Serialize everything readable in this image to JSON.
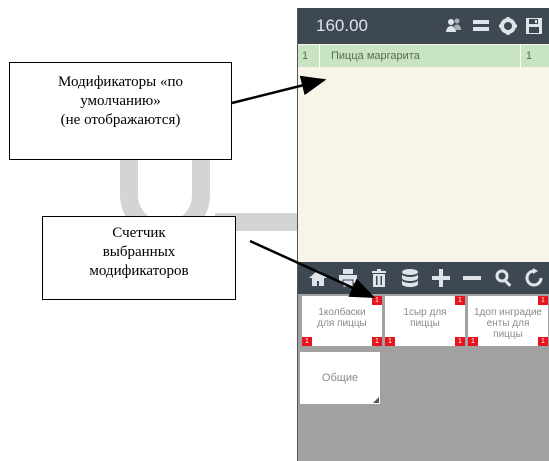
{
  "app": {
    "total": "160.00",
    "toolbar_icons": [
      "users-icon",
      "menu-icon",
      "gear-icon",
      "save-icon"
    ],
    "order_line": {
      "qty_left": "1",
      "name": "Пицца маргарита",
      "qty_right": "1"
    },
    "bottom_tools": [
      "home-icon",
      "print-icon",
      "trash-icon",
      "database-icon",
      "plus-icon",
      "minus-icon",
      "search-icon",
      "refresh-icon"
    ],
    "modifiers": [
      {
        "line1": "1колбаски",
        "line2": "для пиццы",
        "line3": "",
        "top_badge": "1",
        "bottom_left_badge": "1",
        "bottom_right_badge": "1"
      },
      {
        "line1": "1сыр для",
        "line2": "пиццы",
        "line3": "",
        "top_badge": "1",
        "bottom_left_badge": "1",
        "bottom_right_badge": "1"
      },
      {
        "line1": "1доп инградие",
        "line2": "енты для",
        "line3": "пиццы",
        "top_badge": "1",
        "bottom_left_badge": "1",
        "bottom_right_badge": "1"
      }
    ],
    "category": "Общие",
    "colors": {
      "header": "#3d4853",
      "order_line": "#c9e4c2",
      "badge": "#e8141d",
      "panel_bg": "#f8f5e8"
    }
  },
  "callouts": {
    "first": [
      "Модификаторы «по",
      "умолчанию»",
      "(не отображаются)"
    ],
    "second": [
      "Счетчик",
      "выбранных",
      "модификаторов"
    ]
  }
}
